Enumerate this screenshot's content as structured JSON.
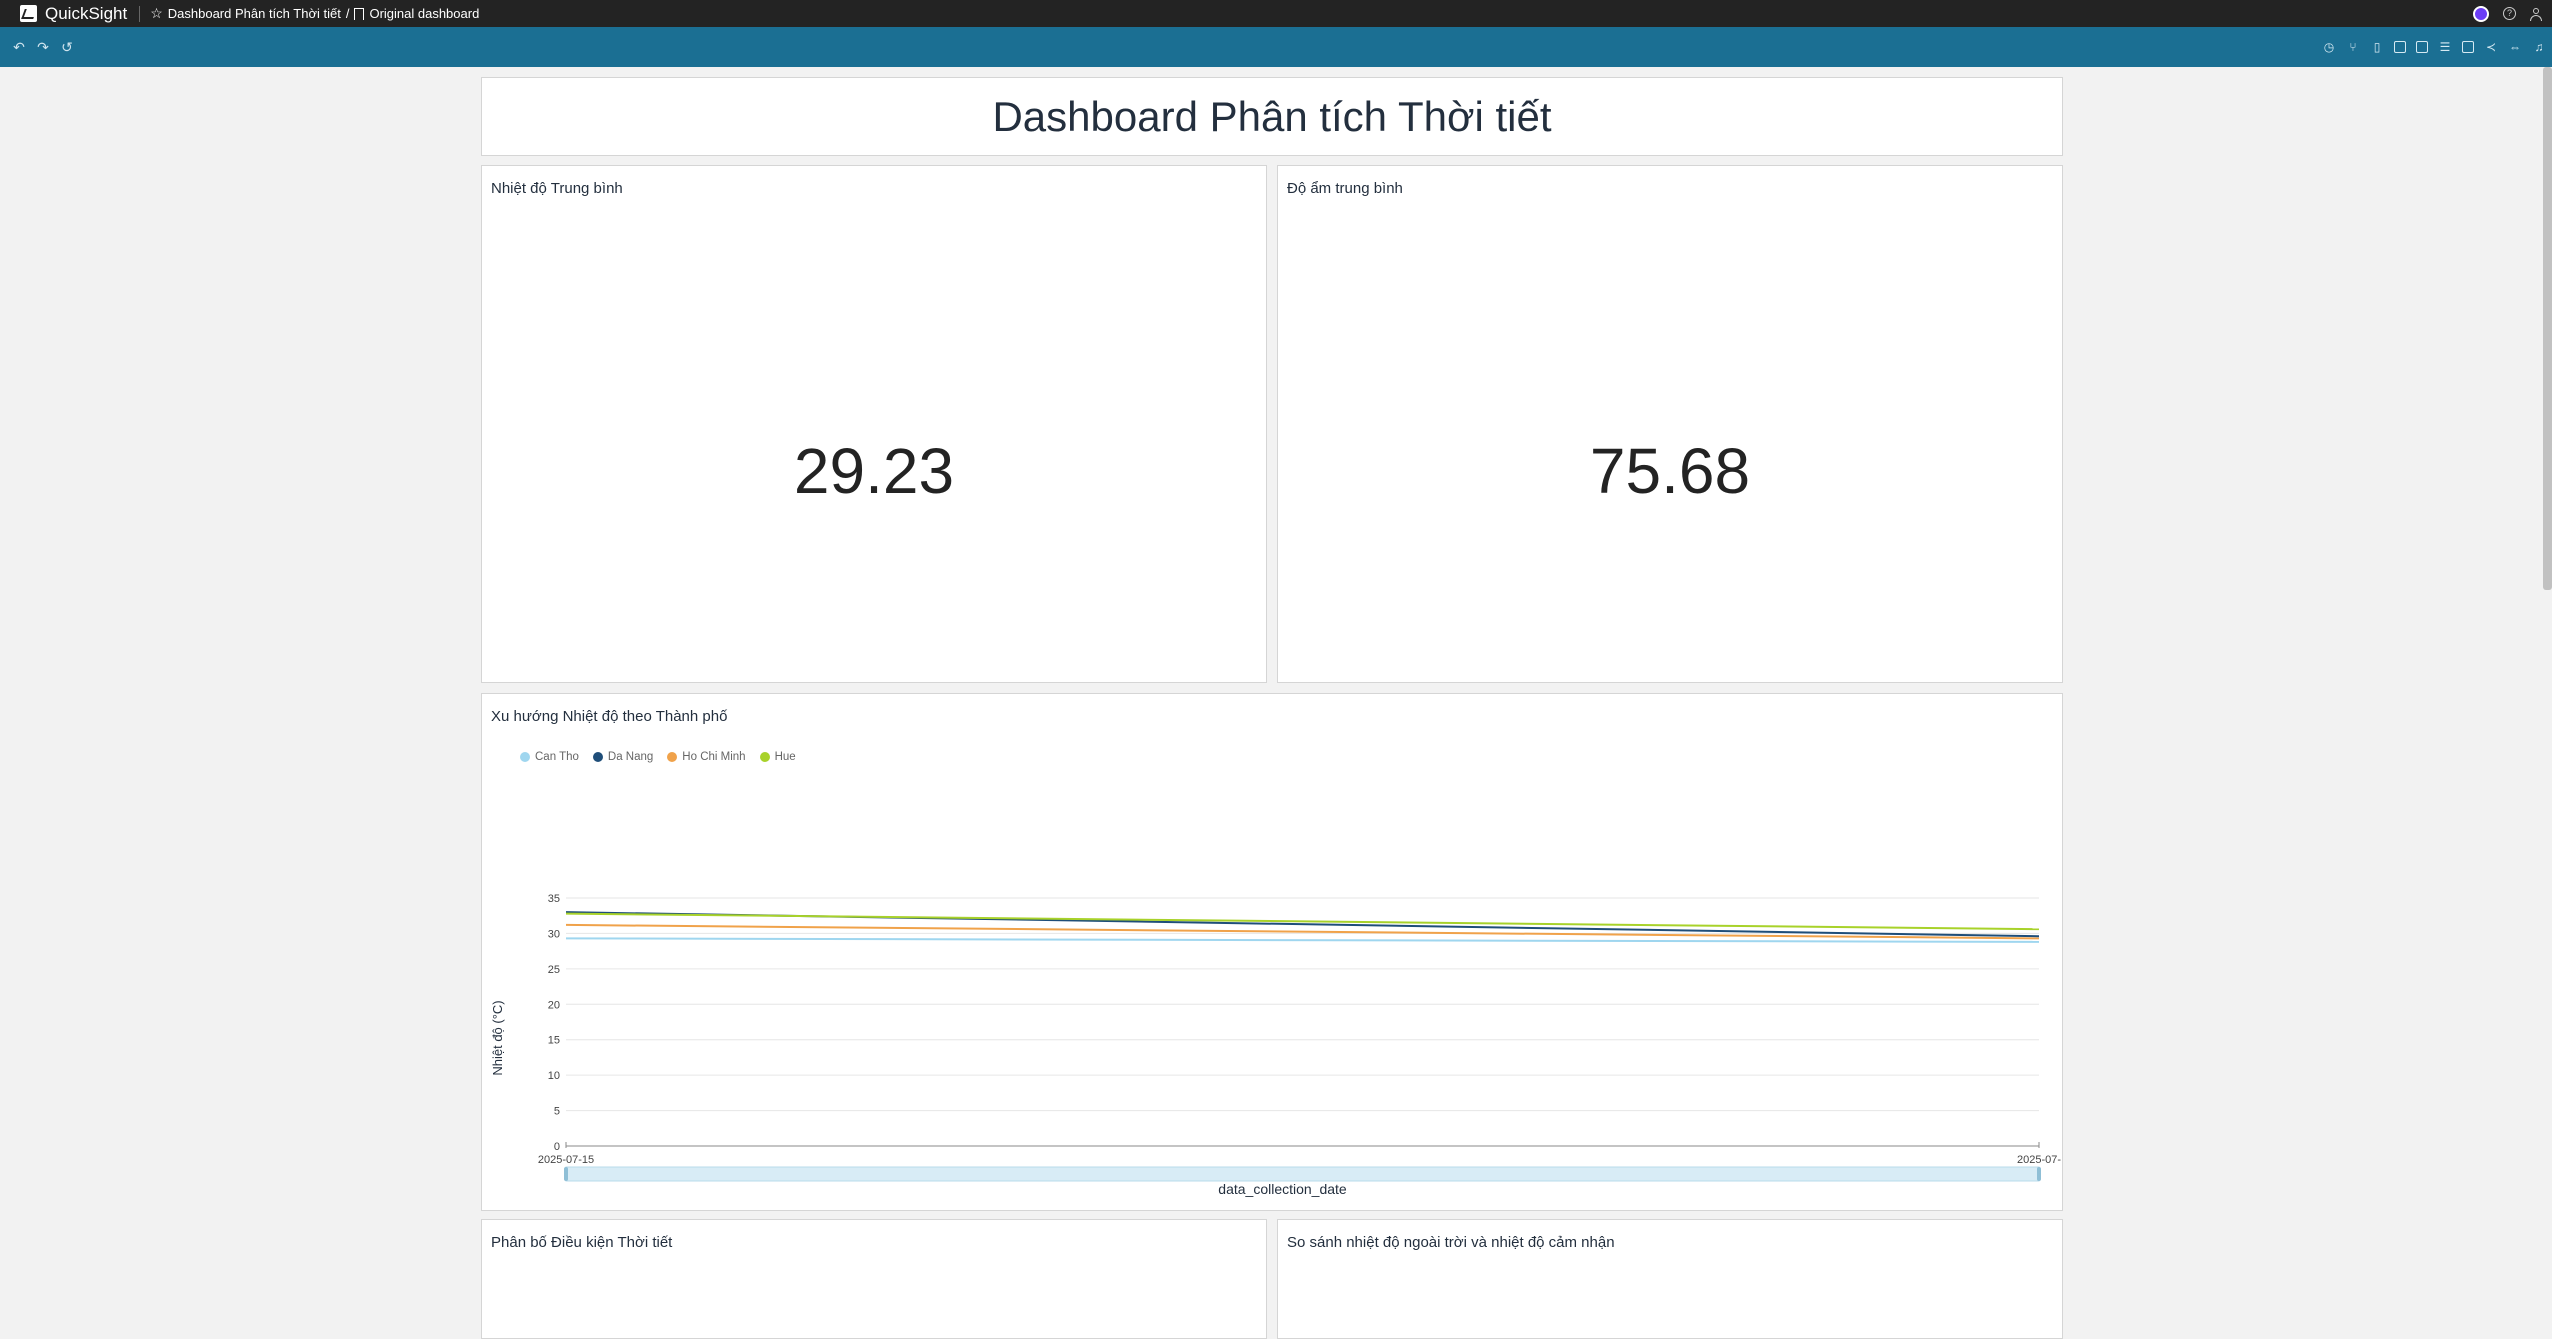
{
  "topbar": {
    "brand": "QuickSight",
    "crumb_title": "Dashboard Phân tích Thời tiết",
    "crumb_sep": "/",
    "crumb_sheet": "Original dashboard"
  },
  "dashboard": {
    "title": "Dashboard Phân tích Thời tiết"
  },
  "kpis": [
    {
      "title": "Nhiệt độ Trung bình",
      "value": "29.23"
    },
    {
      "title": "Độ ẩm trung bình",
      "value": "75.68"
    }
  ],
  "line_chart_card": {
    "title": "Xu hướng Nhiệt độ theo Thành phố"
  },
  "chart_data": {
    "type": "line",
    "title": "Xu hướng Nhiệt độ theo Thành phố",
    "xlabel": "data_collection_date",
    "ylabel": "Nhiệt độ (°C)",
    "x": [
      "2025-07-15",
      "2025-07-"
    ],
    "ylim": [
      0,
      35
    ],
    "yticks": [
      0,
      5,
      10,
      15,
      20,
      25,
      30,
      35
    ],
    "grid": true,
    "legend_position": "top-left",
    "series": [
      {
        "name": "Can Tho",
        "color": "#9fd6ef",
        "values": [
          29.3,
          28.8
        ]
      },
      {
        "name": "Da Nang",
        "color": "#1f4e79",
        "values": [
          33.0,
          29.6
        ]
      },
      {
        "name": "Ho Chi Minh",
        "color": "#f0a24a",
        "values": [
          31.2,
          29.3
        ]
      },
      {
        "name": "Hue",
        "color": "#a8d22a",
        "values": [
          32.8,
          30.6
        ]
      }
    ]
  },
  "bottom_cards": [
    {
      "title": "Phân bố Điều kiện Thời tiết"
    },
    {
      "title": "So sánh nhiệt độ ngoài trời và nhiệt độ cảm nhận"
    }
  ]
}
